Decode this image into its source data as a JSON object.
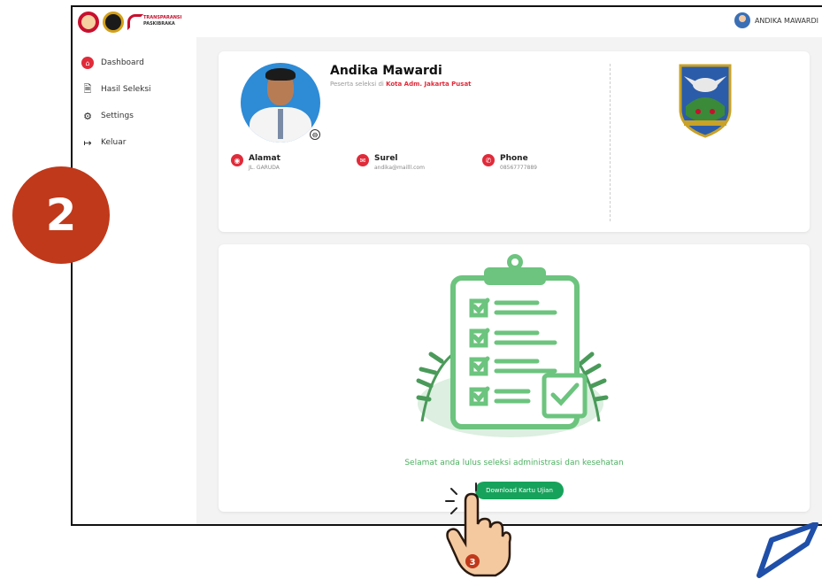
{
  "header": {
    "logo_text_line1": "TRANSPARANSI",
    "logo_text_line2": "PASKIBRAKA",
    "user_name": "ANDIKA MAWARDI"
  },
  "sidebar": {
    "items": [
      {
        "label": "Dashboard",
        "icon": "home-icon"
      },
      {
        "label": "Hasil Seleksi",
        "icon": "document-icon"
      },
      {
        "label": "Settings",
        "icon": "gear-icon"
      },
      {
        "label": "Keluar",
        "icon": "logout-icon"
      }
    ]
  },
  "profile": {
    "name": "Andika Mawardi",
    "role_prefix": "Peserta seleksi di ",
    "role_region": "Kota Adm. Jakarta Pusat",
    "address_label": "Alamat",
    "address_value": "JL. GARUDA",
    "email_label": "Surel",
    "email_value": "andika@mailll.com",
    "phone_label": "Phone",
    "phone_value": "08567777889"
  },
  "result": {
    "message": "Selamat anda lulus seleksi administrasi dan kesehatan",
    "download_label": "Download Kartu Ujian"
  },
  "overlay": {
    "step_badge": "2",
    "hand_step": "3"
  },
  "colors": {
    "accent_red": "#e02b3a",
    "success_green": "#17a25b",
    "badge_red": "#c0391b",
    "illustration_green": "#6cc47e"
  }
}
